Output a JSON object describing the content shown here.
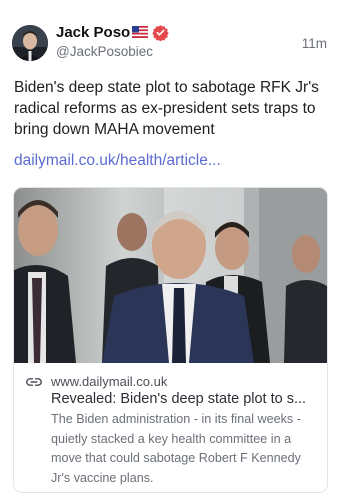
{
  "author": {
    "name": "Jack Poso",
    "handle": "@JackPosobiec",
    "flag_icon": "us-flag-icon",
    "verified_icon": "verified-badge-icon",
    "verified_color": "#e5484d"
  },
  "post": {
    "timestamp": "11m",
    "text": "Biden's deep state plot to sabotage RFK Jr's radical reforms as ex-president sets traps to bring down MAHA movement",
    "link_text": "dailymail.co.uk/health/article...",
    "link_color": "#5a6bd0"
  },
  "card": {
    "link_icon": "link-icon",
    "domain": "www.dailymail.co.uk",
    "title": "Revealed: Biden's deep state plot to s...",
    "description": "The Biden administration - in its final weeks - quietly stacked a key health committee in a move that could sabotage Robert F Kennedy Jr's vaccine plans."
  }
}
